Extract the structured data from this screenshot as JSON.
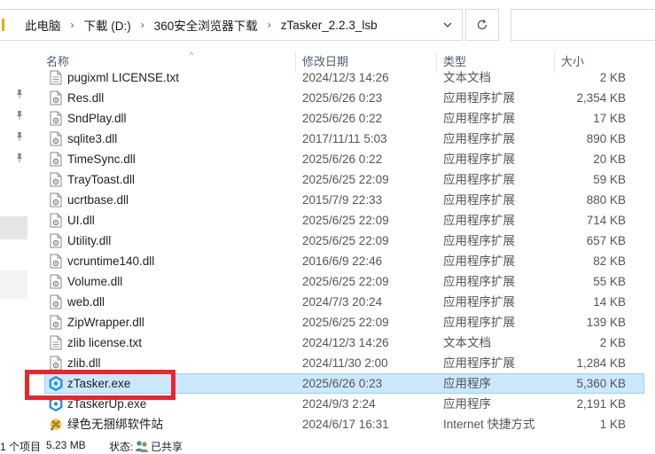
{
  "address": {
    "crumbs": [
      "此电脑",
      "下載 (D:)",
      "360安全浏览器下载",
      "zTasker_2.2.3_lsb"
    ]
  },
  "columns": {
    "name": "名称",
    "date": "修改日期",
    "type": "类型",
    "size": "大小"
  },
  "files": [
    {
      "name": "pugixml LICENSE.txt",
      "date": "2024/12/3 14:26",
      "type": "文本文档",
      "size": "2 KB",
      "icon": "text-file-icon"
    },
    {
      "name": "Res.dll",
      "date": "2025/6/26 0:23",
      "type": "应用程序扩展",
      "size": "2,354 KB",
      "icon": "dll-file-icon"
    },
    {
      "name": "SndPlay.dll",
      "date": "2025/6/26 0:22",
      "type": "应用程序扩展",
      "size": "17 KB",
      "icon": "dll-file-icon"
    },
    {
      "name": "sqlite3.dll",
      "date": "2017/11/11 5:03",
      "type": "应用程序扩展",
      "size": "890 KB",
      "icon": "dll-file-icon"
    },
    {
      "name": "TimeSync.dll",
      "date": "2025/6/26 0:22",
      "type": "应用程序扩展",
      "size": "20 KB",
      "icon": "dll-file-icon"
    },
    {
      "name": "TrayToast.dll",
      "date": "2025/6/25 22:09",
      "type": "应用程序扩展",
      "size": "59 KB",
      "icon": "dll-file-icon"
    },
    {
      "name": "ucrtbase.dll",
      "date": "2015/7/9 22:33",
      "type": "应用程序扩展",
      "size": "880 KB",
      "icon": "dll-file-icon"
    },
    {
      "name": "UI.dll",
      "date": "2025/6/25 22:09",
      "type": "应用程序扩展",
      "size": "714 KB",
      "icon": "dll-file-icon"
    },
    {
      "name": "Utility.dll",
      "date": "2025/6/25 22:09",
      "type": "应用程序扩展",
      "size": "657 KB",
      "icon": "dll-file-icon"
    },
    {
      "name": "vcruntime140.dll",
      "date": "2016/6/9 22:46",
      "type": "应用程序扩展",
      "size": "82 KB",
      "icon": "dll-file-icon"
    },
    {
      "name": "Volume.dll",
      "date": "2025/6/25 22:09",
      "type": "应用程序扩展",
      "size": "55 KB",
      "icon": "dll-file-icon"
    },
    {
      "name": "web.dll",
      "date": "2024/7/3 20:24",
      "type": "应用程序扩展",
      "size": "14 KB",
      "icon": "dll-file-icon"
    },
    {
      "name": "ZipWrapper.dll",
      "date": "2025/6/25 22:09",
      "type": "应用程序扩展",
      "size": "139 KB",
      "icon": "dll-file-icon"
    },
    {
      "name": "zlib license.txt",
      "date": "2024/12/3 14:26",
      "type": "文本文档",
      "size": "2 KB",
      "icon": "text-file-icon"
    },
    {
      "name": "zlib.dll",
      "date": "2024/11/30 2:00",
      "type": "应用程序扩展",
      "size": "1,284 KB",
      "icon": "dll-file-icon"
    },
    {
      "name": "zTasker.exe",
      "date": "2025/6/26 0:23",
      "type": "应用程序",
      "size": "5,360 KB",
      "icon": "ztasker-app-icon",
      "selected": true
    },
    {
      "name": "zTaskerUp.exe",
      "date": "2024/9/3 2:24",
      "type": "应用程序",
      "size": "2,191 KB",
      "icon": "ztasker-app-icon"
    },
    {
      "name": "绿色无捆绑软件站",
      "date": "2024/6/17 16:31",
      "type": "Internet 快捷方式",
      "size": "1 KB",
      "icon": "internet-shortcut-icon"
    }
  ],
  "status": {
    "count": "1 个项目",
    "selected_size": "5.23 MB",
    "state_label": "状态:",
    "share": "已共享"
  },
  "colors": {
    "selection_bg": "#cce8ff",
    "selection_border": "#99d1ff",
    "highlight": "#e8262b",
    "app_icon": "#1e8fd6"
  }
}
